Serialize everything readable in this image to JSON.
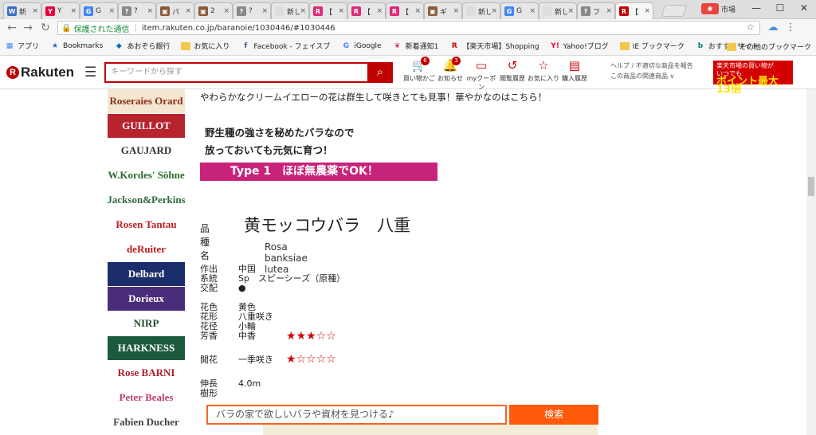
{
  "tabs": [
    {
      "label": "新",
      "color": "#3b6cc4",
      "glyph": "W"
    },
    {
      "label": "Y",
      "color": "#e8003d",
      "glyph": "Y"
    },
    {
      "label": "G",
      "color": "#4285f4",
      "glyph": "G"
    },
    {
      "label": "?",
      "color": "#888888",
      "glyph": "?"
    },
    {
      "label": "バ",
      "color": "#8a5a3a",
      "glyph": "▣"
    },
    {
      "label": "2",
      "color": "#8a5a3a",
      "glyph": "▣"
    },
    {
      "label": "?",
      "color": "#888888",
      "glyph": "?"
    },
    {
      "label": "新し",
      "color": "#dddddd",
      "glyph": ""
    },
    {
      "label": "【",
      "color": "#e0287a",
      "glyph": "R"
    },
    {
      "label": "【",
      "color": "#e0287a",
      "glyph": "R"
    },
    {
      "label": "【",
      "color": "#e0287a",
      "glyph": "R"
    },
    {
      "label": "ギ",
      "color": "#8a5a3a",
      "glyph": "▣"
    },
    {
      "label": "新し",
      "color": "#dddddd",
      "glyph": ""
    },
    {
      "label": "G",
      "color": "#4285f4",
      "glyph": "G"
    },
    {
      "label": "新し",
      "color": "#dddddd",
      "glyph": ""
    },
    {
      "label": "フ",
      "color": "#888888",
      "glyph": "?"
    },
    {
      "label": "【",
      "color": "#bf0000",
      "glyph": "R"
    }
  ],
  "window": {
    "user": "市場",
    "minimize": "—",
    "maximize": "☐",
    "close": "✕"
  },
  "address": {
    "secure_label": "保護された通信",
    "url": "item.rakuten.co.jp/baranoie/1030446/#1030446"
  },
  "bookmarks": [
    {
      "label": "アプリ",
      "icon": "apps-icon"
    },
    {
      "label": "Bookmarks",
      "icon": "star-icon"
    },
    {
      "label": "あおぞら銀行",
      "icon": "diamond-icon"
    },
    {
      "label": "お気に入り",
      "icon": "folder-icon"
    },
    {
      "label": "Facebook - フェイスブ",
      "icon": "facebook-icon"
    },
    {
      "label": "iGoogle",
      "icon": "google-icon"
    },
    {
      "label": "新着通知1",
      "icon": "butterfly-icon"
    },
    {
      "label": "【楽天市場】Shopping",
      "icon": "rakuten-icon"
    },
    {
      "label": "Yahoo!ブログ",
      "icon": "yahoo-icon"
    },
    {
      "label": "IE ブックマーク",
      "icon": "folder-icon"
    },
    {
      "label": "おすすめサイト",
      "icon": "bing-icon"
    }
  ],
  "bookmarks_other": "その他のブックマーク",
  "rakuten": {
    "logo": "Rakuten",
    "search_placeholder": "キーワードから探す",
    "icons": [
      {
        "label": "買い物かご",
        "glyph": "🛒",
        "count": "6"
      },
      {
        "label": "お知らせ",
        "glyph": "🔔",
        "count": "3"
      },
      {
        "label": "myクーポン",
        "glyph": "▭",
        "count": ""
      },
      {
        "label": "閲覧履歴",
        "glyph": "↺",
        "count": ""
      },
      {
        "label": "お気に入り",
        "glyph": "☆",
        "count": ""
      },
      {
        "label": "購入履歴",
        "glyph": "▤",
        "count": ""
      }
    ],
    "help_line1": "ヘルプ / 不適切な商品を報告",
    "help_line2": "この商品の関連商品 ∨",
    "banner_top": "楽天市場の買い物が",
    "banner_mid": "いつでも",
    "banner_big": "ポイント最大13倍"
  },
  "makers": [
    {
      "name": "Roseraies Orard",
      "color": "#8b2d1a",
      "bg": "#f5e6cf"
    },
    {
      "name": "GUILLOT",
      "color": "#ffffff",
      "bg": "#b8242e"
    },
    {
      "name": "GAUJARD",
      "color": "#333333",
      "bg": "#ffffff"
    },
    {
      "name": "W.Kordes' Söhne",
      "color": "#2d6b2f",
      "bg": "#ffffff"
    },
    {
      "name": "Jackson&Perkins",
      "color": "#2f6a3a",
      "bg": "#ffffff"
    },
    {
      "name": "Rosen Tantau",
      "color": "#c02020",
      "bg": "#ffffff"
    },
    {
      "name": "deRuiter",
      "color": "#c01a1a",
      "bg": "#ffffff"
    },
    {
      "name": "Delbard",
      "color": "#ffffff",
      "bg": "#1b2e6b"
    },
    {
      "name": "Dorieux",
      "color": "#ffffff",
      "bg": "#4a2d7a"
    },
    {
      "name": "NIRP",
      "color": "#1e4e2a",
      "bg": "#ffffff"
    },
    {
      "name": "HARKNESS",
      "color": "#ffffff",
      "bg": "#1c5a3e"
    },
    {
      "name": "Rose BARNI",
      "color": "#b01d2a",
      "bg": "#ffffff"
    },
    {
      "name": "Peter Beales",
      "color": "#c0406a",
      "bg": "#ffffff"
    },
    {
      "name": "Fabien Ducher",
      "color": "#444444",
      "bg": "#ffffff"
    }
  ],
  "product": {
    "intro": "やわらかなクリームイエローの花は群生して咲きとても見事！華やかなのはこちら！",
    "catch1": "野生種の強さを秘めたバラなので",
    "catch2": "放っておいても元気に育つ！",
    "type_bar": "Type 1　ほぼ無農薬でOK！",
    "variety_label": "品種名",
    "variety_name": "黄モッコウバラ　八重",
    "latin_name": "Rosa banksiae lutea",
    "specs": [
      {
        "key": "作出",
        "value": "中国"
      },
      {
        "key": "系統",
        "value": "Sp　スピーシーズ（原種）"
      },
      {
        "key": "交配",
        "value": "●"
      },
      {
        "key": "花色",
        "value": "黄色"
      },
      {
        "key": "花形",
        "value": "八重咲き"
      },
      {
        "key": "花径",
        "value": "小輪"
      },
      {
        "key": "芳香",
        "value": "中香"
      },
      {
        "key": "開花",
        "value": "一季咲き"
      },
      {
        "key": "伸長",
        "value": "4.0m"
      },
      {
        "key": "樹形",
        "value": ""
      }
    ],
    "fragrance_rating": 3,
    "bloom_rating": 1,
    "max_rating": 5
  },
  "bottom_search": {
    "placeholder": "バラの家で欲しいバラや資材を見つける♪",
    "button": "検索"
  }
}
